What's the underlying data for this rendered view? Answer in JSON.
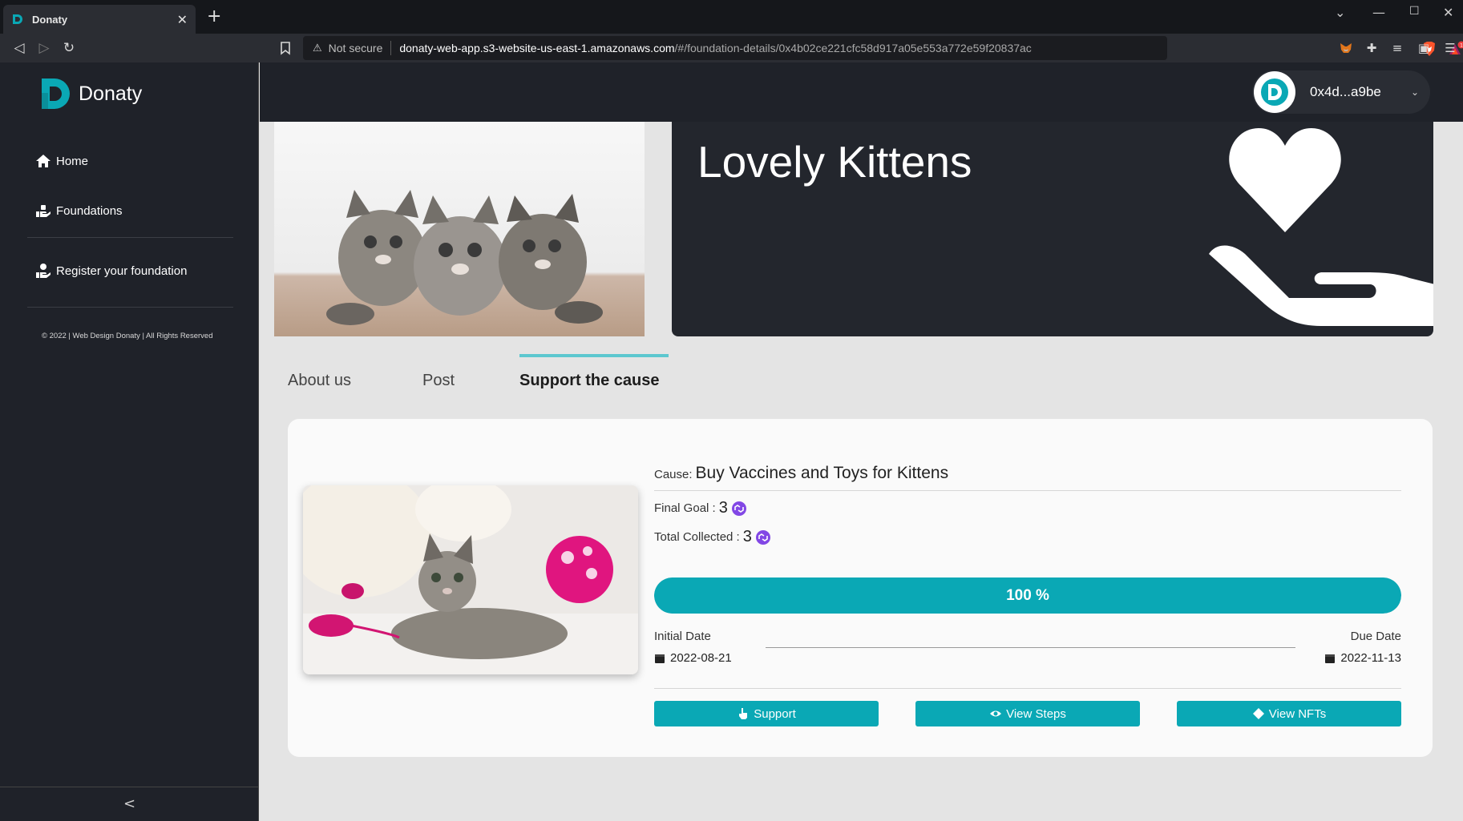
{
  "browser": {
    "tab_title": "Donaty",
    "new_tab": "+",
    "security_label": "Not secure",
    "url_host": "donaty-web-app.s3-website-us-east-1.amazonaws.com",
    "url_path": "/#/foundation-details/0x4b02ce221cfc58d917a05e553a772e59f20837ac"
  },
  "sidebar": {
    "brand": "Donaty",
    "items": [
      {
        "label": "Home",
        "icon": "home-icon"
      },
      {
        "label": "Foundations",
        "icon": "hand-donate-icon"
      },
      {
        "label": "Register your foundation",
        "icon": "register-icon"
      }
    ],
    "copyright": "© 2022 | Web Design Donaty | All Rights Reserved",
    "collapse": "<"
  },
  "account": {
    "address": "0x4d...a9be"
  },
  "foundation": {
    "name": "Lovely Kittens"
  },
  "tabs": [
    {
      "label": "About us",
      "active": false
    },
    {
      "label": "Post",
      "active": false
    },
    {
      "label": "Support the cause",
      "active": true
    }
  ],
  "cause": {
    "label": "Cause:",
    "title": "Buy Vaccines and Toys for Kittens",
    "final_goal_label": "Final Goal :",
    "final_goal_value": "3",
    "total_collected_label": "Total Collected :",
    "total_collected_value": "3",
    "progress_percent": 100,
    "progress_text": "100 %",
    "initial_date_label": "Initial Date",
    "initial_date": "2022-08-21",
    "due_date_label": "Due Date",
    "due_date": "2022-11-13"
  },
  "buttons": {
    "support": "Support",
    "view_steps": "View Steps",
    "view_nfts": "View NFTs"
  },
  "colors": {
    "accent": "#0aa8b5",
    "sidebar_bg": "#1f2229",
    "page_bg": "#e4e4e4",
    "coin": "#8247e5"
  }
}
